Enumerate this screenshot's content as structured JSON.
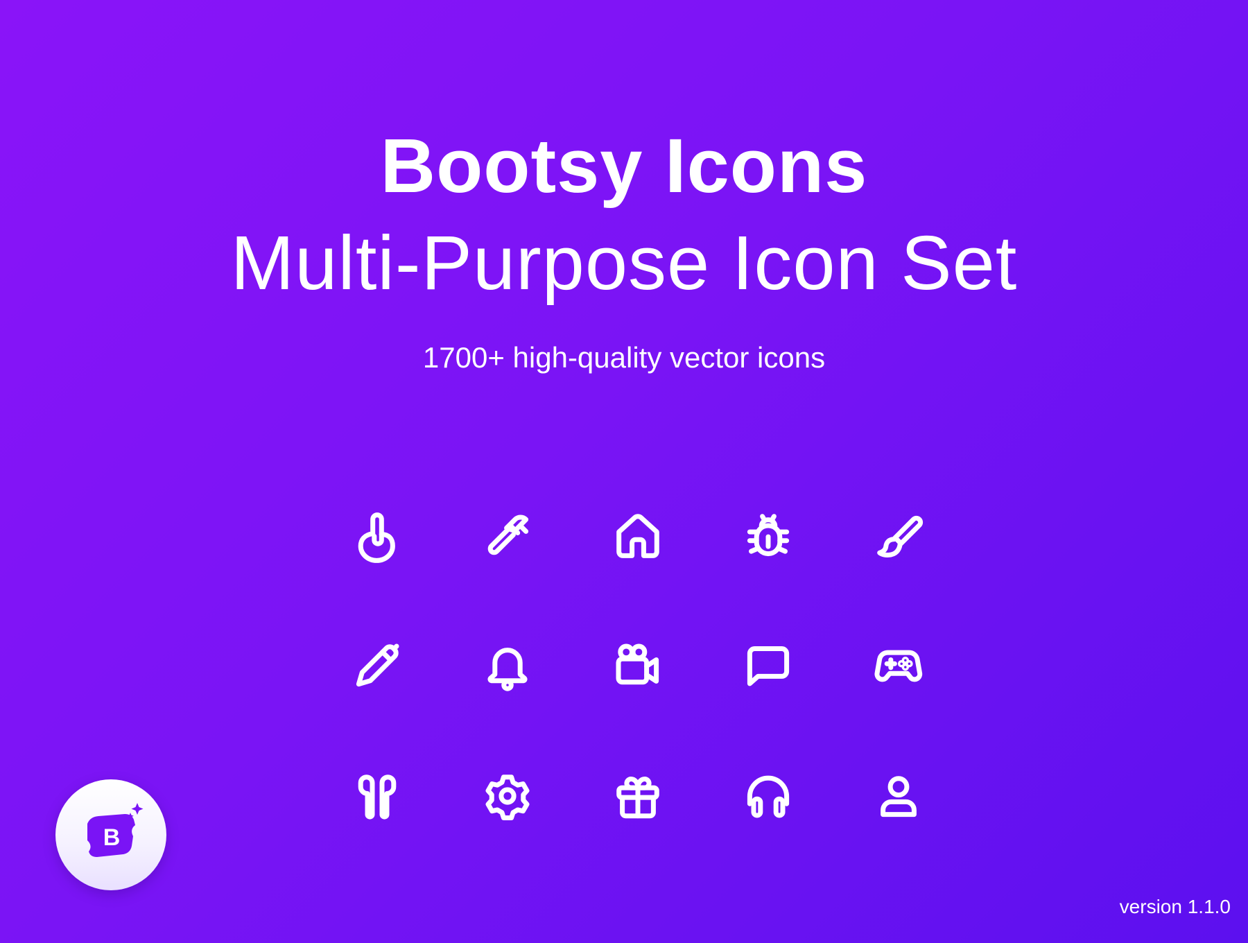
{
  "banner": {
    "title": "Bootsy Icons",
    "subtitle": "Multi-Purpose Icon Set",
    "tagline": "1700+ high-quality vector icons"
  },
  "icons": [
    {
      "name": "hand-finger-icon"
    },
    {
      "name": "hammer-icon"
    },
    {
      "name": "home-icon"
    },
    {
      "name": "bug-icon"
    },
    {
      "name": "paint-brush-icon"
    },
    {
      "name": "pencil-icon"
    },
    {
      "name": "bell-icon"
    },
    {
      "name": "video-camera-icon"
    },
    {
      "name": "chat-bubble-icon"
    },
    {
      "name": "gamepad-icon"
    },
    {
      "name": "earbuds-icon"
    },
    {
      "name": "gear-icon"
    },
    {
      "name": "gift-icon"
    },
    {
      "name": "headphones-icon"
    },
    {
      "name": "user-icon"
    }
  ],
  "logo": {
    "letter": "B",
    "icon": "bootsy-logo-icon"
  },
  "footer": {
    "version": "version 1.1.0"
  },
  "colors": {
    "gradient_start": "#8a14f8",
    "gradient_end": "#5c10ef",
    "text": "#ffffff",
    "logo_badge": "#7a14f5"
  }
}
